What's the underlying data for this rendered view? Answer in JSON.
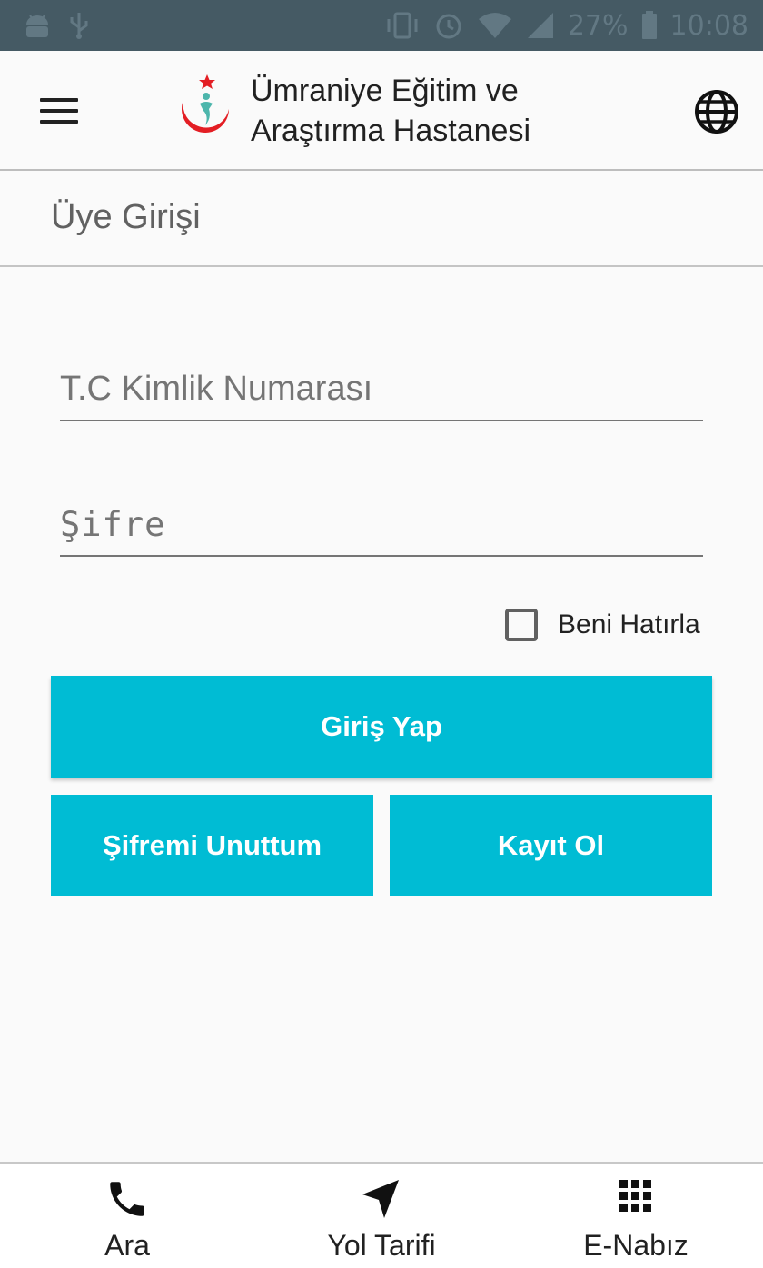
{
  "status_bar": {
    "battery": "27%",
    "time": "10:08",
    "icons": [
      "android-debug-icon",
      "usb-icon",
      "vibrate-icon",
      "alarm-icon",
      "wifi-icon",
      "signal-icon",
      "battery-icon"
    ]
  },
  "app_bar": {
    "title_line1": "Ümraniye Eğitim ve",
    "title_line2": "Araştırma Hastanesi",
    "menu_icon": "hamburger-menu-icon",
    "language_icon": "globe-icon"
  },
  "section": {
    "title": "Üye Girişi"
  },
  "form": {
    "tc_placeholder": "T.C Kimlik Numarası",
    "tc_value": "",
    "password_placeholder": "Şifre",
    "password_value": "",
    "remember_label": "Beni Hatırla",
    "remember_checked": false
  },
  "buttons": {
    "login": "Giriş Yap",
    "forgot": "Şifremi Unuttum",
    "register": "Kayıt Ol"
  },
  "bottom_nav": [
    {
      "label": "Ara",
      "icon": "phone-icon"
    },
    {
      "label": "Yol Tarifi",
      "icon": "navigation-arrow-icon"
    },
    {
      "label": "E-Nabız",
      "icon": "apps-grid-icon"
    }
  ],
  "colors": {
    "status_bar": "#455a64",
    "accent": "#00bcd4",
    "logo_red": "#e31e24",
    "logo_teal": "#4db6ac"
  }
}
